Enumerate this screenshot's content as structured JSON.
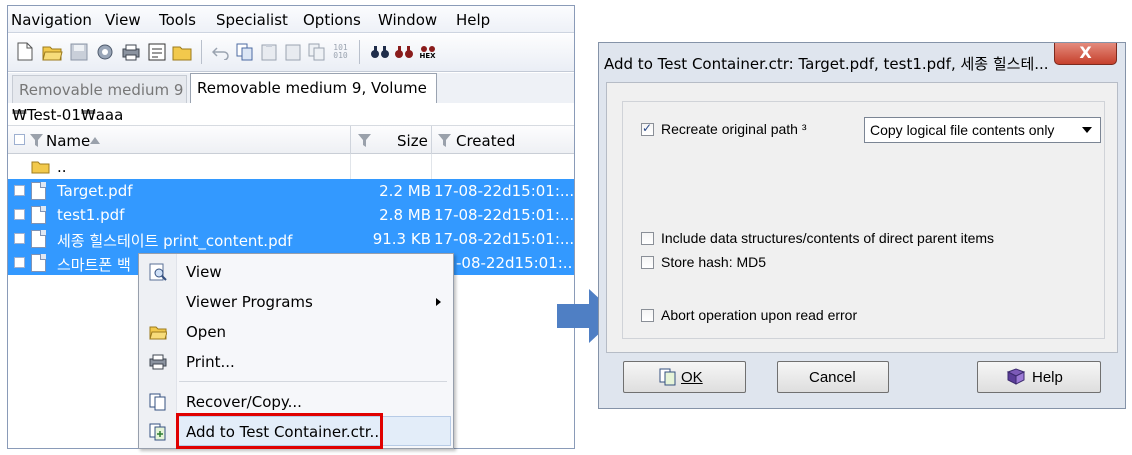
{
  "explorer": {
    "menu": [
      "Navigation",
      "View",
      "Tools",
      "Specialist",
      "Options",
      "Window",
      "Help"
    ],
    "toolbar_icons": [
      "new-doc-icon",
      "open-folder-icon",
      "save-icon",
      "gear-icon",
      "print-icon",
      "properties-icon",
      "folder-icon",
      "undo-icon",
      "copy-icon",
      "paste-icon",
      "clipboard-icon",
      "copy2-icon",
      "binary-icon",
      "search-icon",
      "search-next-icon",
      "hex-search-icon"
    ],
    "binary_glyph": "101\n010",
    "hex_label": "HEX",
    "tabs": [
      "Removable medium 9",
      "Removable medium 9, Volume"
    ],
    "path": "₩Test-01₩aaa",
    "columns": {
      "name": "Name",
      "size": "Size",
      "created": "Created"
    },
    "parent_row": "..",
    "rows": [
      {
        "name": "Target.pdf",
        "size": "2.2 MB",
        "created": "17-08-22d15:01:..."
      },
      {
        "name": "test1.pdf",
        "size": "2.8 MB",
        "created": "17-08-22d15:01:..."
      },
      {
        "name": "세종 힐스테이트 print_content.pdf",
        "size": "91.3 KB",
        "created": "17-08-22d15:01:..."
      },
      {
        "name": "스마트폰 백",
        "size": "",
        "created": "-08-22d15:01:..."
      }
    ]
  },
  "context_menu": {
    "items": [
      {
        "label": "View",
        "icon": "view-icon"
      },
      {
        "label": "Viewer Programs",
        "icon": ""
      },
      {
        "label": "Open",
        "icon": "open-folder-icon"
      },
      {
        "label": "Print...",
        "icon": "print-icon"
      },
      {
        "label": "Recover/Copy...",
        "icon": "copy-files-icon"
      },
      {
        "label": "Add to Test Container.ctr...",
        "icon": "add-container-icon"
      }
    ]
  },
  "dialog": {
    "title": "Add to Test Container.ctr: Target.pdf, test1.pdf, 세종 힐스테...",
    "close": "X",
    "recreate_path": {
      "label": "Recreate original path ³",
      "checked": true
    },
    "copy_mode": "Copy logical file contents only",
    "include_parent": {
      "label": "Include data structures/contents of direct parent items",
      "checked": false
    },
    "store_hash": {
      "label": "Store hash: MD5",
      "checked": false
    },
    "abort_on_error": {
      "label": "Abort operation upon read error",
      "checked": false
    },
    "buttons": {
      "ok": "OK",
      "cancel": "Cancel",
      "help": "Help"
    }
  },
  "colors": {
    "selection": "#3399ff",
    "highlight_box": "#e00000",
    "arrow": "#4f7fc4"
  }
}
